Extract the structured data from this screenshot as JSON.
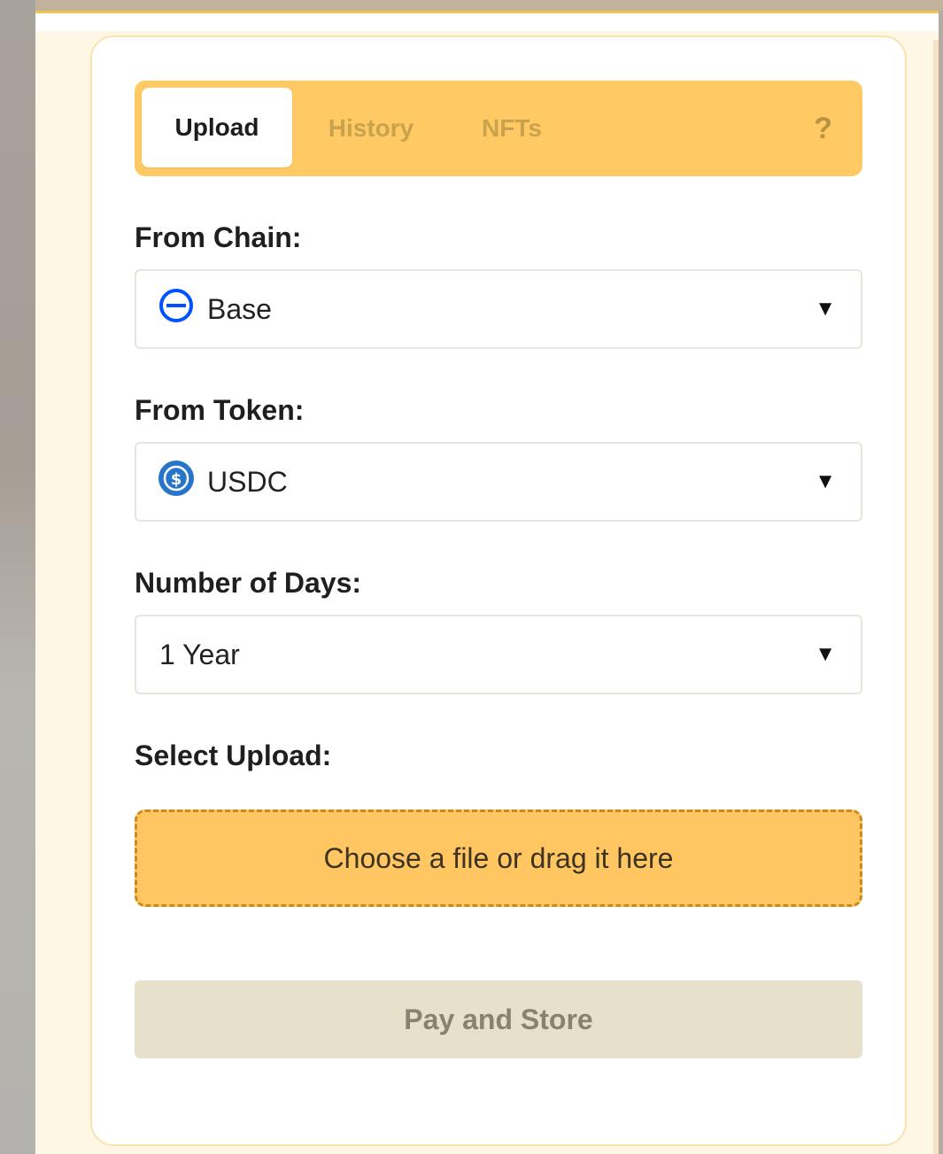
{
  "tabs": {
    "upload": "Upload",
    "history": "History",
    "nfts": "NFTs",
    "help": "?"
  },
  "form": {
    "from_chain_label": "From Chain:",
    "from_chain_value": "Base",
    "from_token_label": "From Token:",
    "from_token_value": "USDC",
    "days_label": "Number of Days:",
    "days_value": "1 Year",
    "upload_label": "Select Upload:",
    "dropzone_text": "Choose a file or drag it here",
    "pay_button": "Pay and Store"
  },
  "icons": {
    "chain": "base-chain-icon",
    "token": "usdc-token-icon",
    "caret": "triangle-down-icon"
  },
  "colors": {
    "accent": "#ffca64",
    "dropzone": "#ffc662",
    "base_blue": "#0052ff",
    "usdc_blue": "#2775ca",
    "pay_disabled": "#e7e0cb"
  }
}
